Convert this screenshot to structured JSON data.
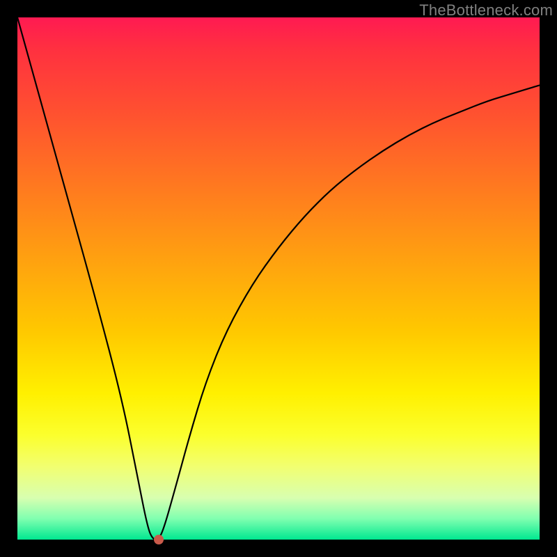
{
  "watermark": "TheBottleneck.com",
  "chart_data": {
    "type": "line",
    "title": "",
    "xlabel": "",
    "ylabel": "",
    "xlim": [
      0,
      100
    ],
    "ylim": [
      0,
      100
    ],
    "grid": false,
    "series": [
      {
        "name": "curve",
        "x": [
          0,
          5,
          10,
          15,
          20,
          23,
          25,
          26,
          27,
          28,
          30,
          33,
          36,
          40,
          45,
          50,
          55,
          60,
          65,
          70,
          75,
          80,
          85,
          90,
          95,
          100
        ],
        "values": [
          100,
          82,
          64,
          46,
          27,
          12,
          2,
          0,
          0,
          2,
          9,
          20,
          30,
          40,
          49,
          56,
          62,
          67,
          71,
          74.5,
          77.5,
          80,
          82,
          84,
          85.5,
          87
        ]
      }
    ],
    "marker": {
      "x": 27,
      "y": 0,
      "color": "#c95a4a"
    },
    "gradient_stops": [
      {
        "pct": 0,
        "color": "#ff1a52"
      },
      {
        "pct": 6,
        "color": "#ff3040"
      },
      {
        "pct": 18,
        "color": "#ff5030"
      },
      {
        "pct": 32,
        "color": "#ff7820"
      },
      {
        "pct": 46,
        "color": "#ffa010"
      },
      {
        "pct": 60,
        "color": "#ffc800"
      },
      {
        "pct": 72,
        "color": "#fff000"
      },
      {
        "pct": 80,
        "color": "#fbff2d"
      },
      {
        "pct": 86,
        "color": "#f2ff70"
      },
      {
        "pct": 92,
        "color": "#d8ffb0"
      },
      {
        "pct": 96,
        "color": "#80ffb0"
      },
      {
        "pct": 100,
        "color": "#00e890"
      }
    ]
  }
}
